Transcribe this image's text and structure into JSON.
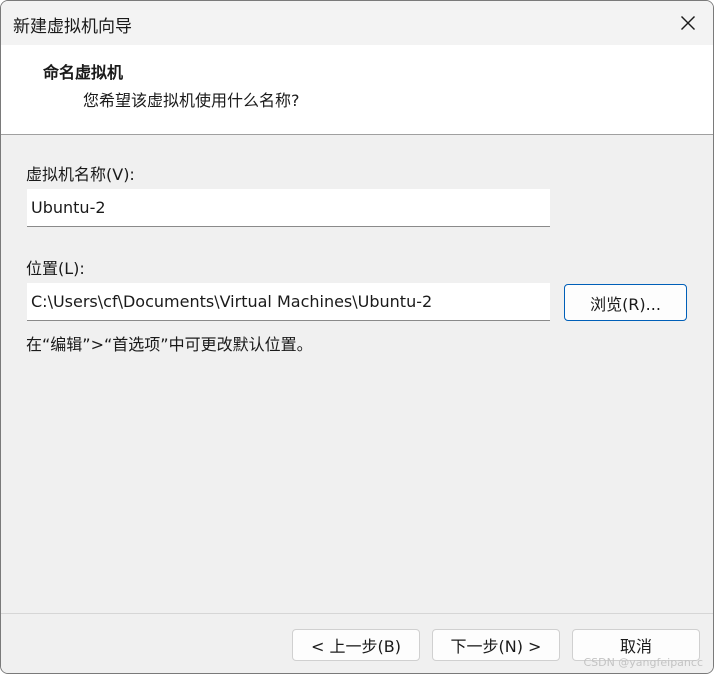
{
  "window": {
    "title": "新建虚拟机向导",
    "close_glyph": "✕"
  },
  "header": {
    "title": "命名虚拟机",
    "subtitle": "您希望该虚拟机使用什么名称?"
  },
  "form": {
    "vm_name_label": "虚拟机名称(V):",
    "vm_name_value": "Ubuntu-2",
    "location_label": "位置(L):",
    "location_value": "C:\\Users\\cf\\Documents\\Virtual Machines\\Ubuntu-2",
    "browse_label": "浏览(R)...",
    "hint": "在“编辑”>“首选项”中可更改默认位置。"
  },
  "footer": {
    "back_label": "< 上一步(B)",
    "next_label": "下一步(N) >",
    "cancel_label": "取消"
  },
  "watermark": "CSDN @yangfeipancc",
  "colors": {
    "focus_border": "#005fb8",
    "dialog_bg": "#f0f0f0",
    "header_bg": "#ffffff"
  }
}
